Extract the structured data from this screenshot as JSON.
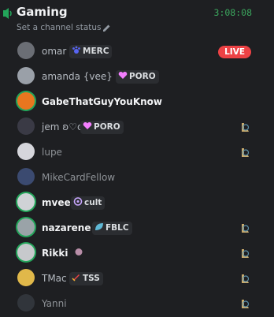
{
  "channel": {
    "name": "Gaming",
    "timer": "3:08:08",
    "status_placeholder": "Set a channel status"
  },
  "users": [
    {
      "name": "omar",
      "badge": "MERC",
      "badge_icon": "paw-icon",
      "live": "LIVE",
      "activity_icon": null,
      "name_color": "#b5bac1",
      "avatar_color": "#6b6e75",
      "speaking": false
    },
    {
      "name": "amanda {vee}",
      "badge": "PORO",
      "badge_icon": "heart-icon",
      "live": null,
      "activity_icon": null,
      "name_color": "#b5bac1",
      "avatar_color": "#9aa0a8",
      "speaking": false
    },
    {
      "name": "GabeThatGuyYouKnow",
      "badge": null,
      "badge_icon": null,
      "live": null,
      "activity_icon": null,
      "name_color": "#f2f3f5",
      "avatar_color": "#e8761f",
      "speaking": true
    },
    {
      "name": "jem ʚ♡ɞ",
      "badge": "PORO",
      "badge_icon": "heart-icon",
      "live": null,
      "activity_icon": "league-icon",
      "name_color": "#b5bac1",
      "avatar_color": "#3a3a45",
      "speaking": false
    },
    {
      "name": "lupe",
      "badge": null,
      "badge_icon": null,
      "live": null,
      "activity_icon": "league-icon",
      "name_color": "#8e9297",
      "avatar_color": "#d6d6dc",
      "speaking": false
    },
    {
      "name": "MikeCardFellow",
      "badge": null,
      "badge_icon": null,
      "live": null,
      "activity_icon": null,
      "name_color": "#8e9297",
      "avatar_color": "#3b4a70",
      "speaking": false
    },
    {
      "name": "mvee",
      "badge": "cult",
      "badge_icon": "swirl-icon",
      "live": null,
      "activity_icon": null,
      "name_color": "#f2f3f5",
      "avatar_color": "#cfd2d6",
      "speaking": true
    },
    {
      "name": "nazarene",
      "badge": "FBLC",
      "badge_icon": "leaf-icon",
      "live": null,
      "activity_icon": "league-icon",
      "name_color": "#f2f3f5",
      "avatar_color": "#9aa3a8",
      "speaking": true
    },
    {
      "name": "Rikki",
      "badge": "",
      "badge_icon": "orb-icon",
      "live": null,
      "activity_icon": "league-icon",
      "name_color": "#f2f3f5",
      "avatar_color": "#c7c9cc",
      "speaking": true
    },
    {
      "name": "TMac",
      "badge": "TSS",
      "badge_icon": "sword-icon",
      "live": null,
      "activity_icon": "league-icon",
      "name_color": "#b5bac1",
      "avatar_color": "#e0b84a",
      "speaking": false
    },
    {
      "name": "Yanni",
      "badge": null,
      "badge_icon": null,
      "live": null,
      "activity_icon": "league-icon",
      "name_color": "#8e9297",
      "avatar_color": "#31353b",
      "speaking": false
    }
  ]
}
